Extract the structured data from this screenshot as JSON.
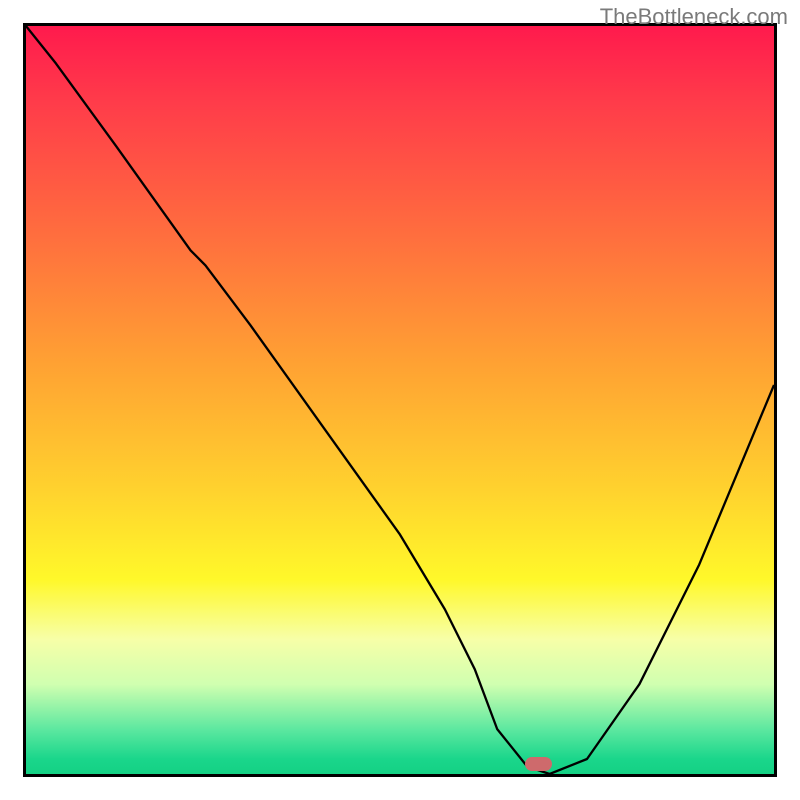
{
  "watermark": {
    "text": "TheBottleneck.com"
  },
  "chart_data": {
    "type": "line",
    "title": "",
    "xlabel": "",
    "ylabel": "",
    "xlim": [
      0,
      100
    ],
    "ylim": [
      0,
      100
    ],
    "grid": false,
    "legend": false,
    "background": "vertical red→green gradient",
    "series": [
      {
        "name": "bottleneck-curve",
        "x": [
          0,
          4,
          12,
          22,
          24,
          30,
          40,
          50,
          56,
          60,
          63,
          67,
          70,
          75,
          82,
          90,
          100
        ],
        "y": [
          100,
          95,
          84,
          70,
          68,
          60,
          46,
          32,
          22,
          14,
          6,
          1,
          0,
          2,
          12,
          28,
          52
        ]
      }
    ],
    "marker": {
      "x": 68.5,
      "y": 1.3,
      "color": "#ce6a6c"
    }
  }
}
